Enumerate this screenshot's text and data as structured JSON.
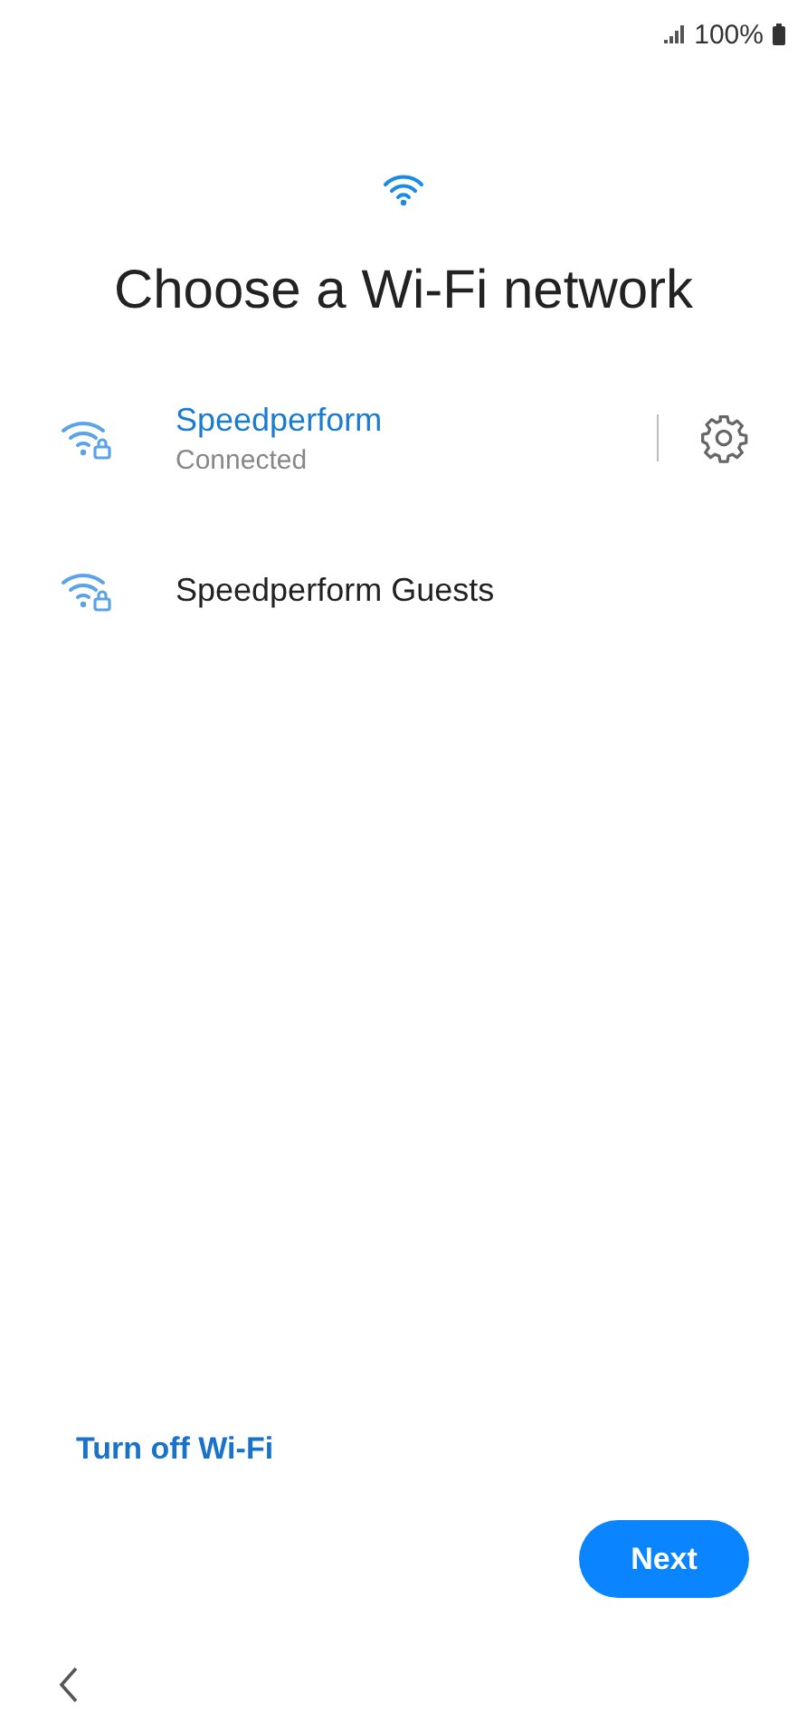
{
  "status_bar": {
    "battery": "100%"
  },
  "title": "Choose a Wi-Fi network",
  "networks": [
    {
      "name": "Speedperform",
      "status": "Connected",
      "connected": true
    },
    {
      "name": "Speedperform Guests",
      "connected": false
    }
  ],
  "turn_off_link": "Turn off Wi-Fi",
  "next_button": "Next"
}
